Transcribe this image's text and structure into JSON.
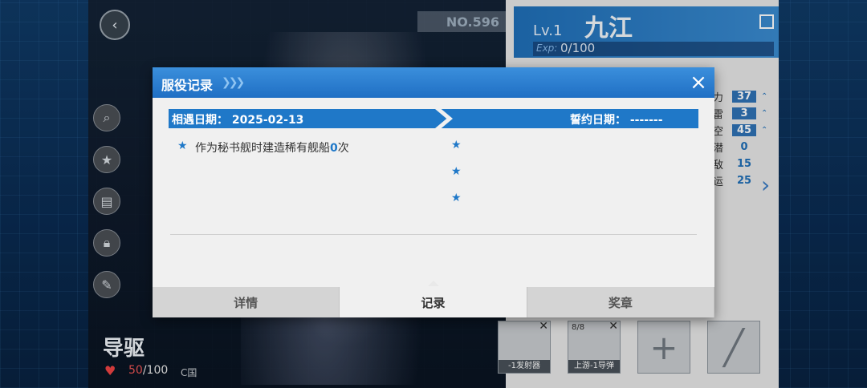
{
  "background": {
    "ship_number": "NO.596",
    "level": "Lv.1",
    "ship_name": "九江",
    "exp_label": "Exp:",
    "exp_value": "0/100",
    "stats": [
      {
        "name": "力",
        "value": "37",
        "boxed": true
      },
      {
        "name": "雷",
        "value": "3",
        "boxed": true
      },
      {
        "name": "空",
        "value": "45",
        "boxed": true
      },
      {
        "name": "潜",
        "value": "0",
        "boxed": false
      },
      {
        "name": "敌",
        "value": "15",
        "boxed": false
      },
      {
        "name": "运",
        "value": "25",
        "boxed": false
      }
    ],
    "bottom": {
      "type_name": "导驱",
      "affection_current": "50",
      "affection_max": "/100",
      "nation": "C国"
    },
    "equipment": [
      {
        "label": "-1发射器",
        "count": ""
      },
      {
        "label": "上游-1导弹",
        "count": "8/8"
      }
    ]
  },
  "modal": {
    "title": "服役记录",
    "close_icon": "×",
    "met_date_label": "相遇日期：",
    "met_date": "2025-02-13",
    "oath_date_label": "誓约日期：",
    "oath_date": "-------",
    "record_prefix": "作为秘书舰时建造稀有舰船",
    "record_count": "0",
    "record_suffix": "次",
    "tabs": [
      {
        "label": "详情",
        "active": false
      },
      {
        "label": "记录",
        "active": true
      },
      {
        "label": "奖章",
        "active": false
      }
    ]
  },
  "colors": {
    "accent": "#1f78c8",
    "header": "#2a82d4"
  }
}
